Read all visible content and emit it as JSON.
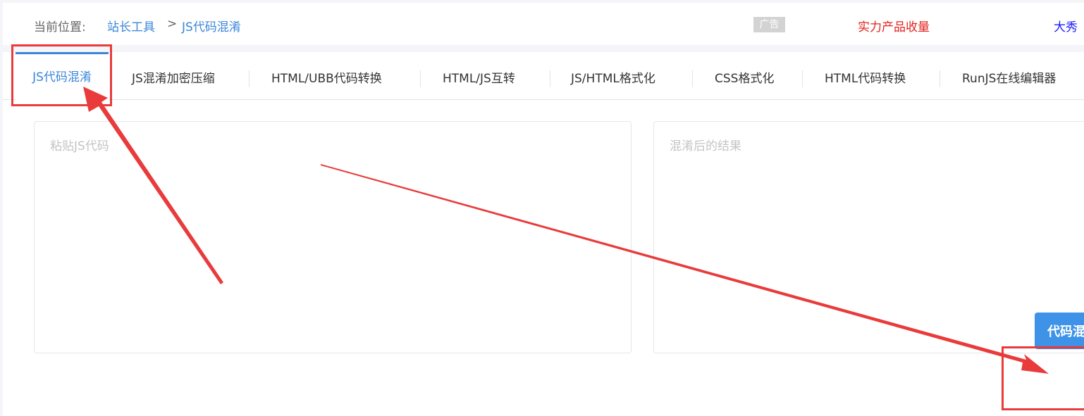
{
  "breadcrumb": {
    "label": "当前位置:",
    "root": "站长工具",
    "separator": ">",
    "current": "JS代码混淆"
  },
  "ad_badge": "广告",
  "promo_links": [
    {
      "text": "实力产品收量",
      "color": "#e2211c"
    },
    {
      "text": "大秀",
      "color": "#1a1aff"
    }
  ],
  "tabs": [
    {
      "label": "JS代码混淆",
      "active": true
    },
    {
      "label": "JS混淆加密压缩",
      "active": false
    },
    {
      "label": "HTML/UBB代码转换",
      "active": false
    },
    {
      "label": "HTML/JS互转",
      "active": false
    },
    {
      "label": "JS/HTML格式化",
      "active": false
    },
    {
      "label": "CSS格式化",
      "active": false
    },
    {
      "label": "HTML代码转换",
      "active": false
    },
    {
      "label": "RunJS在线编辑器",
      "active": false
    }
  ],
  "input_area": {
    "placeholder": "粘贴JS代码",
    "value": ""
  },
  "output_area": {
    "placeholder": "混淆后的结果",
    "value": ""
  },
  "action_button": {
    "label": "代码混淆"
  },
  "colors": {
    "accent": "#3a86d9",
    "button": "#3e92e8",
    "annotation_red": "#e93b3b"
  }
}
